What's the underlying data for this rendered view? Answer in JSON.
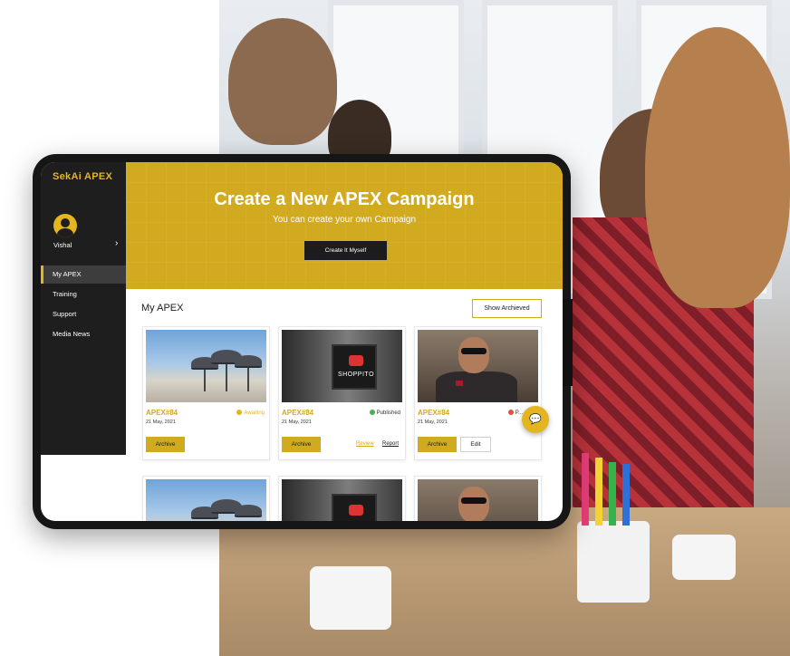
{
  "brand": "SekAi APEX",
  "user": {
    "name": "Vishal"
  },
  "nav": [
    {
      "label": "My APEX",
      "active": true
    },
    {
      "label": "Training",
      "active": false
    },
    {
      "label": "Support",
      "active": false
    },
    {
      "label": "Media News",
      "active": false
    }
  ],
  "banner": {
    "title": "Create a New APEX Campaign",
    "subtitle": "You can create your own Campaign",
    "button": "Create It Myself"
  },
  "section": {
    "title": "My APEX",
    "show_button": "Show Archieved"
  },
  "cards": [
    {
      "id": "APEX#84",
      "date": "21 May, 2021",
      "status": "Awaiting",
      "status_color": "#e3b521",
      "archive": "Archive"
    },
    {
      "id": "APEX#84",
      "date": "21 May, 2021",
      "status": "Published",
      "status_color": "#4caf50",
      "archive": "Archive",
      "review": "Review",
      "report": "Report"
    },
    {
      "id": "APEX#84",
      "date": "21 May, 2021",
      "status": "P...",
      "status_color": "#e0533a",
      "archive": "Archive",
      "edit": "Edit"
    }
  ],
  "shop_sign_text": "SHOPPITO",
  "colors": {
    "accent": "#d2aa1f",
    "sidebar": "#1e1e1e",
    "dark_button": "#1c1c1c"
  },
  "icons": {
    "avatar": "user-avatar-icon",
    "chevron": "chevron-right-icon",
    "chat": "chat-icon"
  }
}
